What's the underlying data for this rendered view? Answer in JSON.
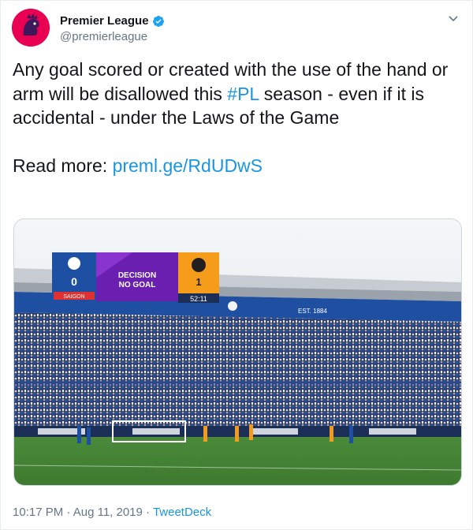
{
  "tweet": {
    "author": {
      "display_name": "Premier League",
      "handle": "@premierleague",
      "verified": true,
      "avatar_icon": "premier-league-lion-icon",
      "brand_color": "#e90052"
    },
    "text": {
      "line1_pre": "Any goal scored or created with the use of the hand or arm will be disallowed this ",
      "hashtag": "#PL",
      "line1_post": " season - even if it is accidental - under the Laws of the Game",
      "read_more_label": "Read more: ",
      "read_more_link": "preml.ge/RdUDwS"
    },
    "media": {
      "scoreboard": {
        "home_score": "0",
        "decision_label": "DECISION",
        "decision_value": "NO GOAL",
        "away_score": "1",
        "clock": "52:11",
        "sponsor": "SAIGON",
        "banner_text": "EST. 1884"
      }
    },
    "footer": {
      "time": "10:17 PM",
      "separator": " · ",
      "date": "Aug 11, 2019",
      "source": "TweetDeck"
    },
    "colors": {
      "link": "#1b95e0",
      "muted": "#657786"
    }
  }
}
